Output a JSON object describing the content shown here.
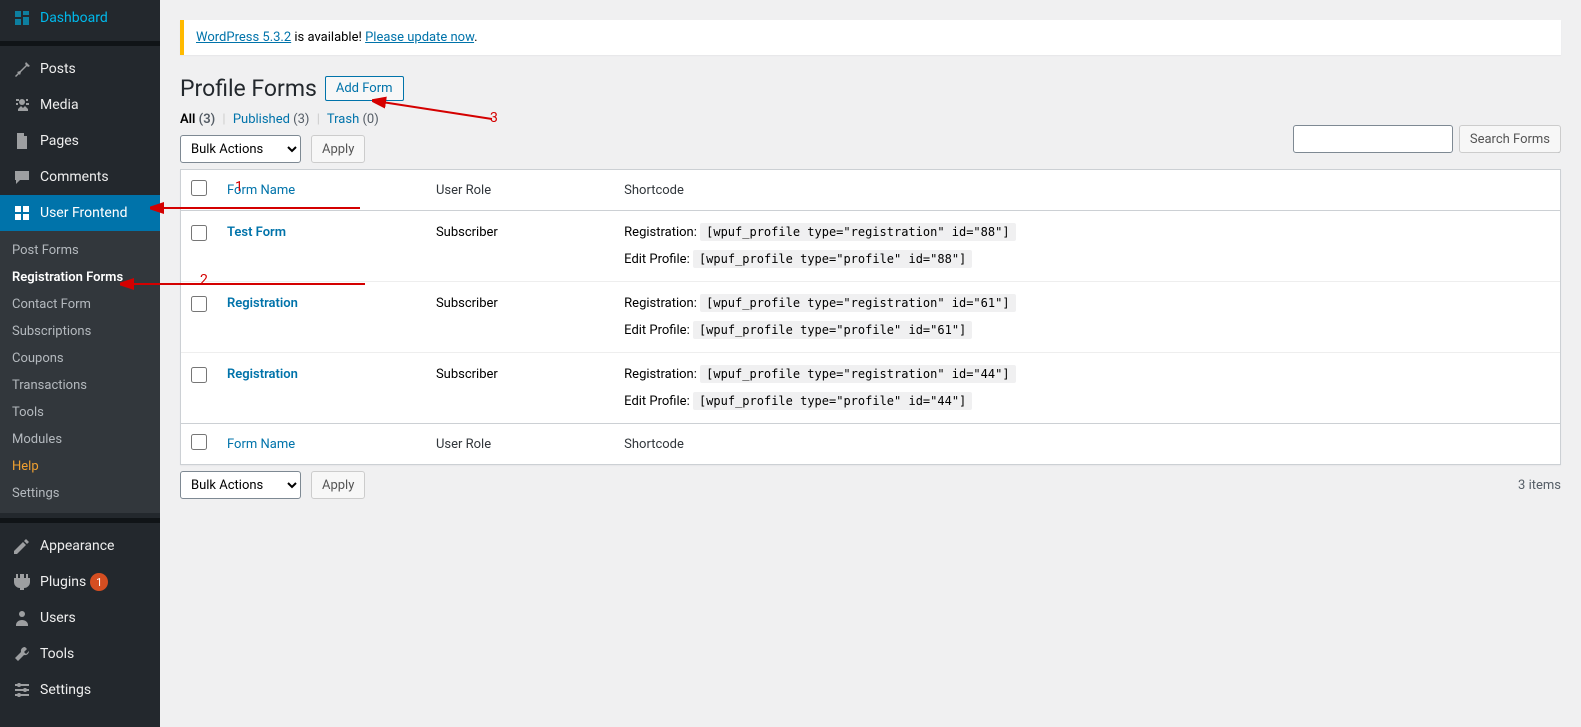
{
  "sidebar": {
    "items": [
      {
        "icon": "dashboard-icon",
        "label": "Dashboard"
      },
      {
        "icon": "pin-icon",
        "label": "Posts"
      },
      {
        "icon": "media-icon",
        "label": "Media"
      },
      {
        "icon": "page-icon",
        "label": "Pages"
      },
      {
        "icon": "comment-icon",
        "label": "Comments"
      },
      {
        "icon": "frontend-icon",
        "label": "User Frontend"
      },
      {
        "icon": "appearance-icon",
        "label": "Appearance"
      },
      {
        "icon": "plugin-icon",
        "label": "Plugins",
        "badge": "1"
      },
      {
        "icon": "users-icon",
        "label": "Users"
      },
      {
        "icon": "tools-icon",
        "label": "Tools"
      },
      {
        "icon": "settings-icon",
        "label": "Settings"
      }
    ],
    "submenu": [
      {
        "label": "Post Forms"
      },
      {
        "label": "Registration Forms",
        "current": true
      },
      {
        "label": "Contact Form"
      },
      {
        "label": "Subscriptions"
      },
      {
        "label": "Coupons"
      },
      {
        "label": "Transactions"
      },
      {
        "label": "Tools"
      },
      {
        "label": "Modules"
      },
      {
        "label": "Help",
        "help": true
      },
      {
        "label": "Settings"
      }
    ]
  },
  "notice": {
    "prefix": "WordPress 5.3.2",
    "text": " is available! ",
    "link": "Please update now",
    "suffix": "."
  },
  "page": {
    "title": "Profile Forms",
    "add_button": "Add Form"
  },
  "filters": {
    "all_label": "All",
    "all_count": "(3)",
    "published_label": "Published",
    "published_count": "(3)",
    "trash_label": "Trash",
    "trash_count": "(0)"
  },
  "bulk": {
    "placeholder": "Bulk Actions",
    "apply": "Apply"
  },
  "items_count": "3 items",
  "search": {
    "button": "Search Forms"
  },
  "table": {
    "headers": {
      "form_name": "Form Name",
      "user_role": "User Role",
      "shortcode": "Shortcode"
    },
    "shortcode_labels": {
      "registration": "Registration:",
      "edit_profile": "Edit Profile:"
    },
    "rows": [
      {
        "name": "Test Form",
        "role": "Subscriber",
        "reg_code": "[wpuf_profile type=\"registration\" id=\"88\"]",
        "profile_code": "[wpuf_profile type=\"profile\" id=\"88\"]"
      },
      {
        "name": "Registration",
        "role": "Subscriber",
        "reg_code": "[wpuf_profile type=\"registration\" id=\"61\"]",
        "profile_code": "[wpuf_profile type=\"profile\" id=\"61\"]"
      },
      {
        "name": "Registration",
        "role": "Subscriber",
        "reg_code": "[wpuf_profile type=\"registration\" id=\"44\"]",
        "profile_code": "[wpuf_profile type=\"profile\" id=\"44\"]"
      }
    ]
  },
  "annotations": {
    "a1": "1",
    "a2": "2",
    "a3": "3"
  }
}
